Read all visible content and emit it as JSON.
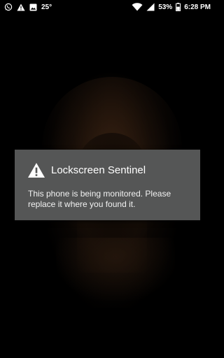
{
  "status_bar": {
    "left_icons": [
      "whatsapp-icon",
      "warning-icon",
      "image-icon"
    ],
    "temperature": "25°",
    "battery_percent": "53%",
    "time": "6:28 PM",
    "right_icons": [
      "wifi-icon",
      "signal-icon",
      "battery-icon"
    ]
  },
  "dialog": {
    "icon": "warning-icon",
    "title": "Lockscreen Sentinel",
    "message": "This phone is being monitored. Please replace it where you found it."
  },
  "colors": {
    "dialog_background": "#555656",
    "text": "#ffffff",
    "screen_background": "#000000"
  }
}
